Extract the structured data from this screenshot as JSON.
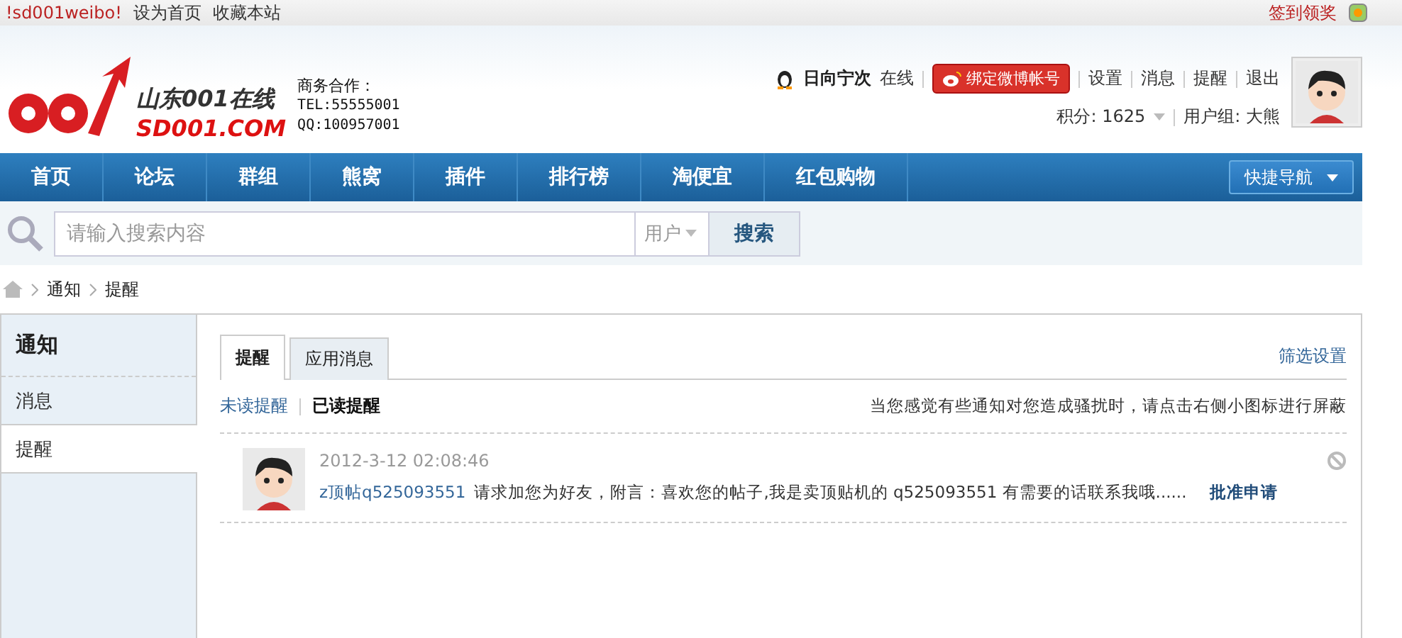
{
  "top_bar": {
    "links": [
      {
        "label": "!sd001weibo!",
        "kind": "brand"
      },
      {
        "label": "设为首页",
        "kind": "plain"
      },
      {
        "label": "收藏本站",
        "kind": "plain"
      }
    ],
    "checkin": "签到领奖"
  },
  "logo": {
    "name": "山东001在线",
    "domain": "SD001.COM"
  },
  "contact": {
    "title": "商务合作：",
    "lines": [
      "TEL:55555001",
      "QQ:100957001"
    ]
  },
  "user": {
    "name": "日向宁次",
    "status": "在线",
    "bind_button": "绑定微博帐号",
    "links": [
      "设置",
      "消息",
      "提醒",
      "退出"
    ],
    "points": "积分: 1625",
    "group": "用户组: 大熊"
  },
  "nav": {
    "items": [
      {
        "label": "首页",
        "selected": false
      },
      {
        "label": "论坛",
        "selected": false
      },
      {
        "label": "群组",
        "selected": false
      },
      {
        "label": "熊窝",
        "selected": false
      },
      {
        "label": "插件",
        "selected": false
      },
      {
        "label": "排行榜",
        "selected": false
      },
      {
        "label": "淘便宜",
        "selected": false
      },
      {
        "label": "红包购物",
        "selected": false
      }
    ],
    "quick_nav": "快捷导航"
  },
  "search": {
    "placeholder": "请输入搜索内容",
    "scope": "用户",
    "button": "搜索"
  },
  "breadcrumb": [
    "通知",
    "提醒"
  ],
  "sidebar": {
    "title": "通知",
    "items": [
      {
        "label": "消息",
        "selected": false
      },
      {
        "label": "提醒",
        "selected": true
      }
    ]
  },
  "tabs": [
    {
      "label": "提醒",
      "selected": true
    },
    {
      "label": "应用消息",
      "selected": false
    }
  ],
  "filter_settings": "筛选设置",
  "subtabs": [
    {
      "label": "未读提醒",
      "selected": false
    },
    {
      "label": "已读提醒",
      "selected": true
    }
  ],
  "hint": "当您感觉有些通知对您造成骚扰时，请点击右侧小图标进行屏蔽",
  "notifications": [
    {
      "time": "2012-3-12 02:08:46",
      "user": "z顶帖q525093551",
      "text": "请求加您为好友，附言：喜欢您的帖子,我是卖顶贴机的 q525093551 有需要的话联系我哦......",
      "action": "批准申请"
    }
  ]
}
